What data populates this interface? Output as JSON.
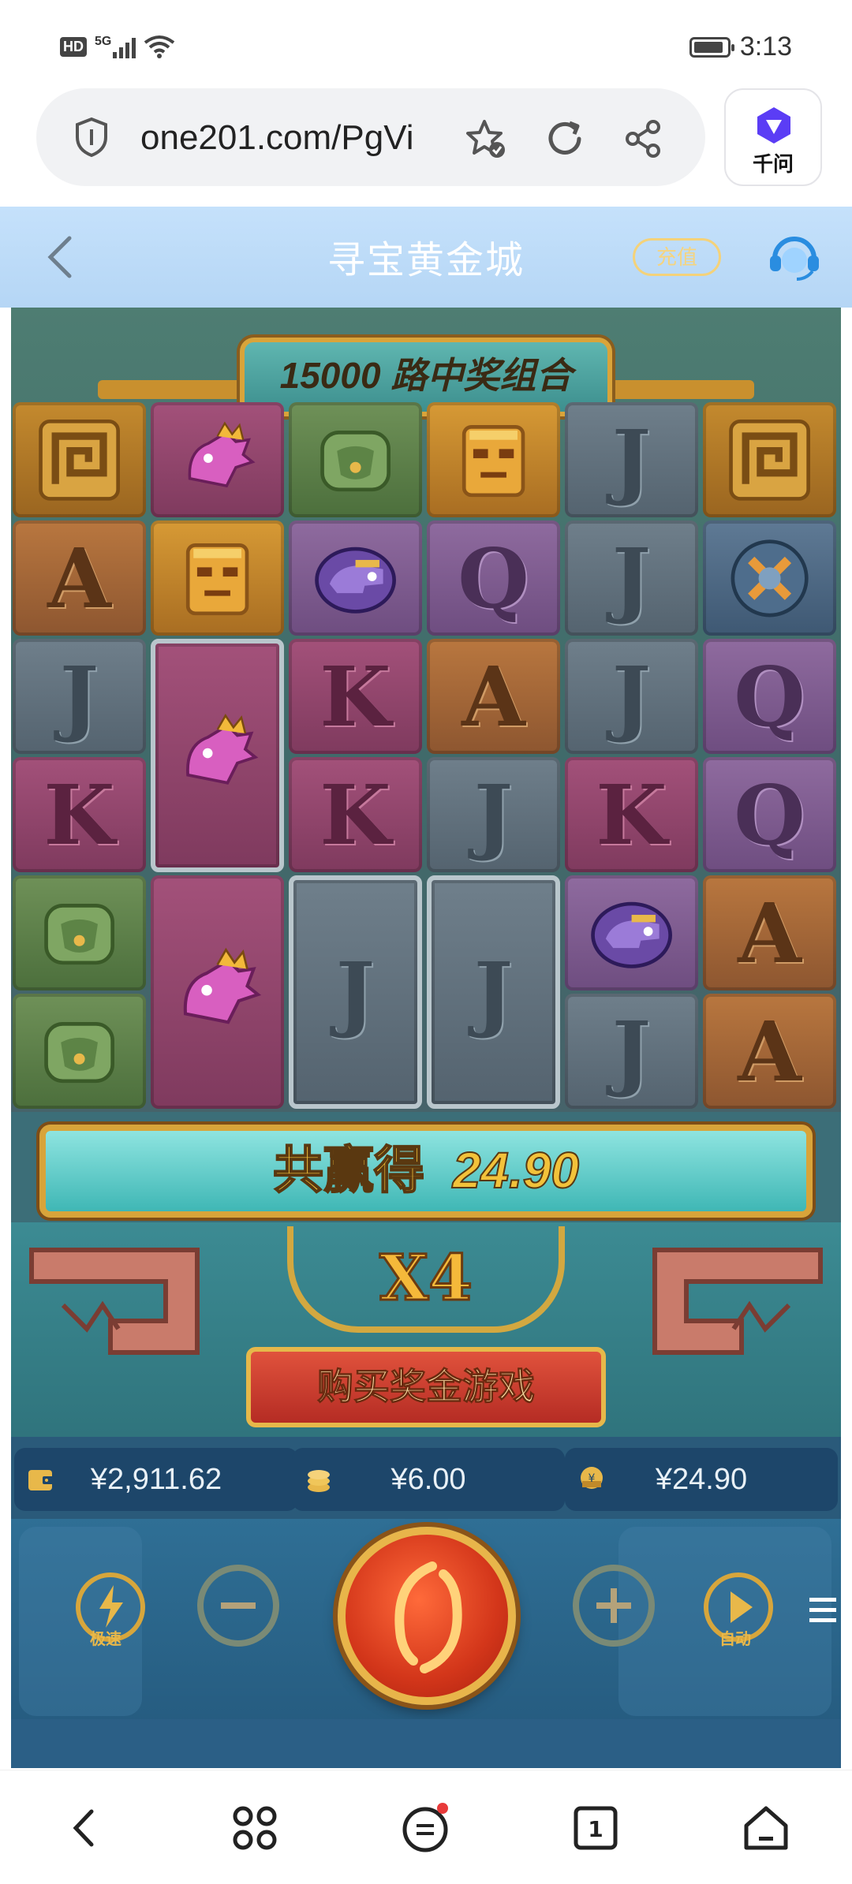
{
  "status_bar": {
    "left_badge": "HD",
    "network": "5G",
    "time": "3:13"
  },
  "browser": {
    "url": "one201.com/PgVi",
    "assistant_label": "千问"
  },
  "game_header": {
    "title": "寻宝黄金城",
    "recharge_label": "充值"
  },
  "game": {
    "banner_text": "15000 路中奖组合",
    "grid": [
      [
        "spiral",
        "pink-dragon",
        "green-mask",
        "gold-mask",
        "J",
        "spiral"
      ],
      [
        "A",
        "gold-mask",
        "purple-serpent",
        "Q",
        "J",
        "steel-emblem"
      ],
      [
        "J",
        "pink-dragon",
        "K",
        "A",
        "J",
        "Q"
      ],
      [
        "K",
        "pink-dragon",
        "K",
        "J",
        "K",
        "Q"
      ],
      [
        "green-mask",
        "pink-dragon",
        "J",
        "J",
        "purple-serpent",
        "A"
      ],
      [
        "green-mask",
        "pink-dragon",
        "J",
        "J",
        "J",
        "A"
      ]
    ],
    "win_label": "共赢得",
    "win_amount": "24.90",
    "multiplier": "X4",
    "buy_bonus_label": "购买奖金游戏"
  },
  "stats": {
    "balance": "¥2,911.62",
    "bet": "¥6.00",
    "win": "¥24.90"
  },
  "controls": {
    "turbo_label": "极速",
    "auto_label": "自动"
  },
  "colors": {
    "header_bg": "#c5e1fb",
    "win_bar": "#3fb7b5",
    "gold_frame": "#d8a43a",
    "buy_button": "#c83a2c",
    "spin_button": "#d3361a"
  }
}
